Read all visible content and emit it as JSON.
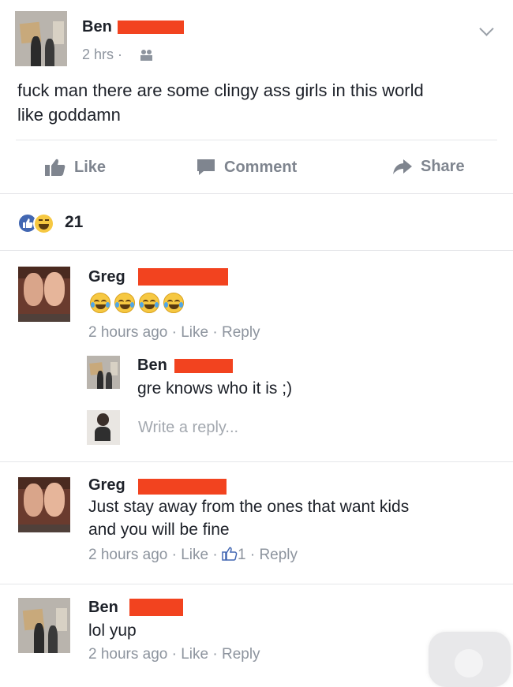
{
  "post": {
    "author": "Ben",
    "time": "2 hrs",
    "separator": "·",
    "text_line1": "fuck man there are some clingy ass girls in this world",
    "text_line2": "like goddamn",
    "actions": {
      "like": "Like",
      "comment": "Comment",
      "share": "Share"
    },
    "reaction_count": "21"
  },
  "comments": [
    {
      "author": "Greg",
      "emoji_count": 4,
      "meta": "2 hours ago · Like · Reply",
      "reply": {
        "author": "Ben",
        "text": "gre knows who it is ;)"
      },
      "write_reply_placeholder": "Write a reply..."
    },
    {
      "author": "Greg",
      "text_line1": "Just stay away from the ones that want kids",
      "text_line2": "and you will be fine",
      "meta_prefix": "2 hours ago · Like · ",
      "like_count": "1",
      "meta_suffix": " · Reply"
    },
    {
      "author": "Ben",
      "text": "lol yup",
      "meta": "2 hours ago · Like · Reply"
    }
  ],
  "colors": {
    "like_blue": "#4267b2",
    "redaction": "#f2431f",
    "meta_gray": "#8d949e"
  }
}
